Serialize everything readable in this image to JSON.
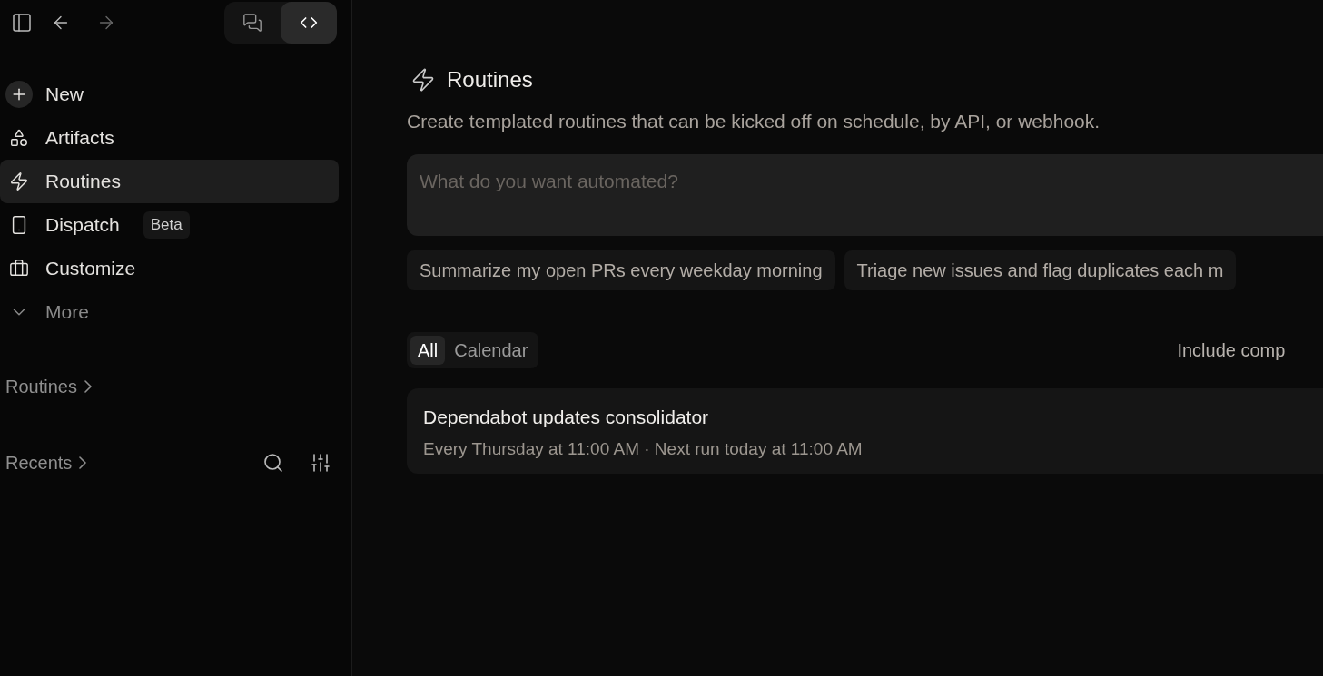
{
  "toolbar": {
    "modes": [
      {
        "kind": "chat",
        "selected": false
      },
      {
        "kind": "code",
        "selected": true
      }
    ]
  },
  "sidebar": {
    "items": [
      {
        "label": "New",
        "kind": "new",
        "selected": false
      },
      {
        "label": "Artifacts",
        "kind": "link",
        "selected": false
      },
      {
        "label": "Routines",
        "kind": "link",
        "selected": true
      },
      {
        "label": "Dispatch",
        "kind": "link",
        "selected": false,
        "badge": "Beta"
      },
      {
        "label": "Customize",
        "kind": "link",
        "selected": false
      },
      {
        "label": "More",
        "kind": "expander",
        "selected": false
      }
    ],
    "sections": [
      {
        "label": "Routines",
        "tools": false
      },
      {
        "label": "Recents",
        "tools": true
      }
    ]
  },
  "main": {
    "title": "Routines",
    "description": "Create templated routines that can be kicked off on schedule, by API, or webhook.",
    "prompt": {
      "placeholder": "What do you want automated?"
    },
    "suggestions": [
      "Summarize my open PRs every weekday morning",
      "Triage new issues and flag duplicates each m"
    ],
    "tabs": [
      {
        "label": "All",
        "selected": true
      },
      {
        "label": "Calendar",
        "selected": false
      }
    ],
    "include_toggle": "Include comp",
    "routines": [
      {
        "name": "Dependabot updates consolidator",
        "schedule": "Every Thursday at 11:00 AM · Next run today at 11:00 AM"
      }
    ]
  }
}
